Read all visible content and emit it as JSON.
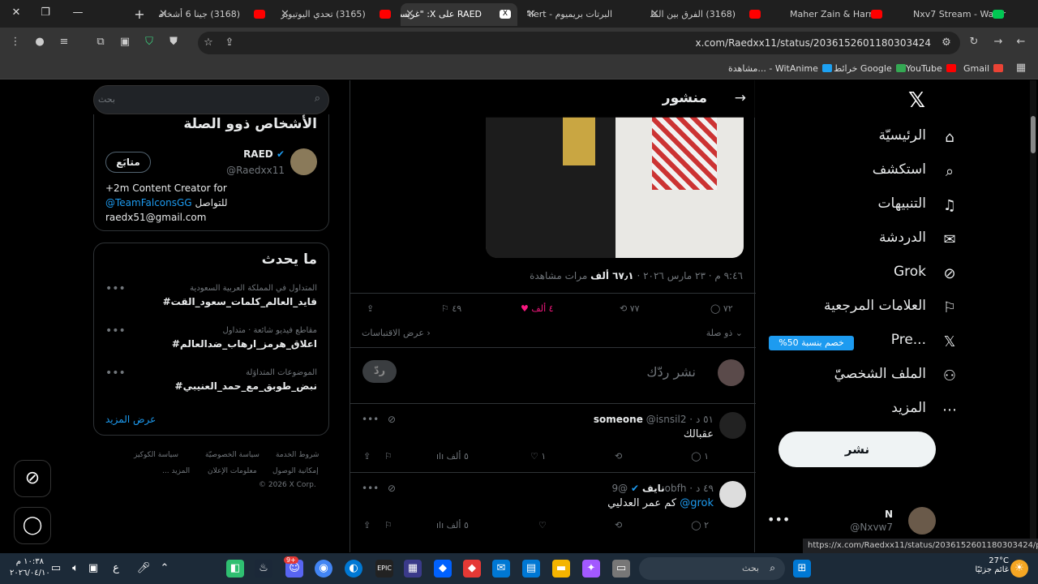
{
  "browser": {
    "tabs": [
      {
        "title": "(3168) جينا 6 أشخاص",
        "fav_color": "#ff0000"
      },
      {
        "title": "(3165) تحدي اليوتيوبر",
        "fav_color": "#ff0000"
      },
      {
        "title": "RAED على X: \"غريسنا\"",
        "fav_color": "#ffffff"
      },
      {
        "title": "البرتات بريميوم - Alert",
        "fav_color": "#ff0000"
      },
      {
        "title": "(3168) الفرق بين الملك",
        "fav_color": "#ff0000"
      },
      {
        "title": "Maher Zain & Harris",
        "fav_color": "#ff0000"
      },
      {
        "title": "Nxv7 Stream - Watch",
        "fav_color": "#00c853"
      }
    ],
    "new_tab": "+",
    "url": "x.com/Raedxx11/status/2036152601180303424",
    "bookmarks": [
      {
        "label": "Gmail",
        "color": "#ea4335"
      },
      {
        "label": "YouTube",
        "color": "#ff0000"
      },
      {
        "label": "خرائط Google",
        "color": "#34a853"
      },
      {
        "label": "مشاهدة... - WitAnime",
        "color": "#1da1f2"
      }
    ],
    "status_url": "https://x.com/Raedxx11/status/2036152601180303424/photo/1"
  },
  "nav": {
    "items": [
      {
        "label": "الرئيسيّة",
        "icon": "home-icon",
        "glyph": "⌂"
      },
      {
        "label": "استكشف",
        "icon": "search-icon",
        "glyph": "⌕"
      },
      {
        "label": "التنبيهات",
        "icon": "bell-icon",
        "glyph": "🔔︎"
      },
      {
        "label": "الدردشة",
        "icon": "mail-icon",
        "glyph": "✉"
      },
      {
        "label": "Grok",
        "icon": "grok-icon",
        "glyph": "⊘"
      },
      {
        "label": "العلامات المرجعية",
        "icon": "bookmark-icon",
        "glyph": "⚐"
      },
      {
        "label": "Pre...",
        "icon": "x-premium-icon",
        "glyph": "𝕏"
      },
      {
        "label": "الملف الشخصيّ",
        "icon": "profile-icon",
        "glyph": "⚇"
      },
      {
        "label": "المزيد",
        "icon": "more-icon",
        "glyph": "⋯"
      }
    ],
    "premium_badge": "%خصم بنسبة 50",
    "post_button": "نشر",
    "account_name": "N",
    "account_handle": "@Nxvw7"
  },
  "post": {
    "header_title": "منشور",
    "meta_time": "٩:٤٦ م · ٢٣ مارس ٢٠٢٦ · ",
    "views_count": "٦٧٫١ ألف",
    "views_label": " مرات مشاهدة",
    "replies": "٧٢",
    "reposts": "٧٧",
    "likes": "٤ ألف",
    "bookmarks": "٤٩",
    "related": "ذو صلة",
    "quotes": "عرض الاقتباسات",
    "reply_placeholder": "نشر ردّك",
    "reply_button": "ردّ"
  },
  "replies": [
    {
      "name": "someone",
      "handle": "@isnsil2",
      "time": "٥١ د",
      "text": "عقبالك",
      "replies": "١",
      "reposts": "",
      "likes": "١",
      "views": "٥ ألف"
    },
    {
      "name": "نايف",
      "handle": "@9obfh",
      "time": "٤٩ د",
      "text": "كم عمر العدليي",
      "mention": "@grok",
      "replies": "٢",
      "reposts": "",
      "likes": "",
      "views": "٥ ألف"
    }
  ],
  "sidebar": {
    "search_placeholder": "بحث",
    "related_title": "الأشخاص ذوو الصلة",
    "person_name": "RAED",
    "person_handle": "@Raedxx11",
    "follow_button": "متابَع",
    "bio_line1": "+2m Content Creator for",
    "bio_mention": "@TeamFalconsGG",
    "bio_line2": " للتواصل",
    "bio_email": "raedx51@gmail.com",
    "trends_title": "ما يحدث",
    "trends": [
      {
        "context": "المتداول في المملكة العربية السعودية",
        "tag": "#قايد_العالم_كلمات_سعود_القت"
      },
      {
        "context": "مقاطع فيديو شائعة · متداول",
        "tag": "#اعلاق_هرمز_ارهاب_ضدالعالم"
      },
      {
        "context": "الموضوعات المتداوَلة",
        "tag": "#نبض_طوبق_مع_حمد_العنيبي"
      }
    ],
    "show_more": "عرض المزيد",
    "footer": [
      "شروط الخدمة",
      "سياسة الخصوصيّة",
      "سياسة الكوكيز",
      "إمكانية الوصول",
      "معلومات الإعلان",
      "... المزيد",
      "© 2026 X Corp."
    ]
  },
  "taskbar": {
    "weather_temp": "27°C",
    "weather_text": "غائم جزئيًا",
    "search_label": "بحث",
    "time": "١٠:٣٨ م",
    "date": "٢٠٢٦/٠٤/١٠",
    "lang": "ع",
    "notif_count": "9+"
  }
}
